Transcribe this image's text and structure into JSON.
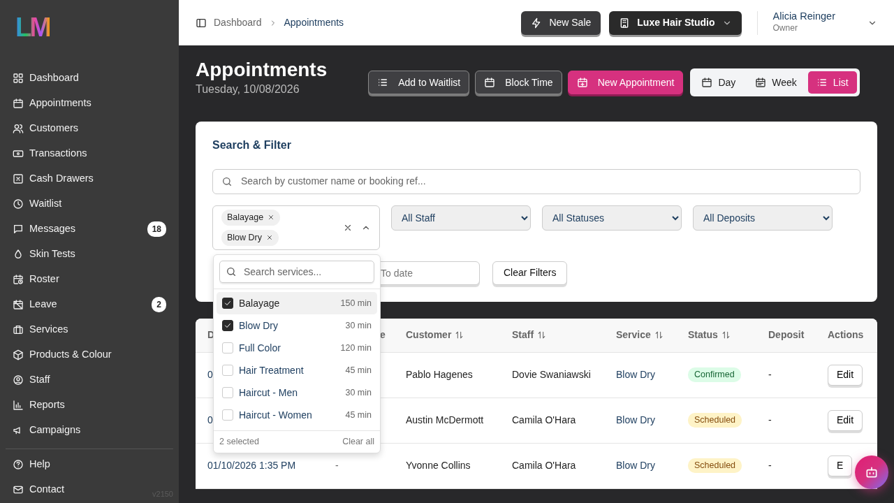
{
  "logo": {
    "text": "LM"
  },
  "sidebar": {
    "items": [
      {
        "label": "Dashboard"
      },
      {
        "label": "Appointments"
      },
      {
        "label": "Customers"
      },
      {
        "label": "Transactions"
      },
      {
        "label": "Cash Drawers"
      },
      {
        "label": "Waitlist"
      },
      {
        "label": "Messages",
        "badge": "18"
      },
      {
        "label": "Skin Tests"
      },
      {
        "label": "Roster"
      },
      {
        "label": "Leave",
        "badge": "2"
      },
      {
        "label": "Services"
      },
      {
        "label": "Products & Colour"
      },
      {
        "label": "Staff"
      },
      {
        "label": "Reports"
      },
      {
        "label": "Campaigns"
      }
    ],
    "footer_items": [
      {
        "label": "Help"
      },
      {
        "label": "Contact"
      }
    ],
    "version": "v2150"
  },
  "header": {
    "breadcrumb": [
      "Dashboard",
      "Appointments"
    ],
    "new_sale": "New Sale",
    "studio": "Luxe Hair Studio",
    "user": {
      "name": "Alicia Reinger",
      "role": "Owner"
    }
  },
  "page": {
    "title": "Appointments",
    "date": "Tuesday, 10/08/2026",
    "actions": [
      {
        "label": "Add to Waitlist",
        "kind": "secondary"
      },
      {
        "label": "Block Time",
        "kind": "secondary"
      },
      {
        "label": "New Appointment",
        "kind": "primary"
      }
    ],
    "views": [
      {
        "label": "Day",
        "selected": false
      },
      {
        "label": "Week",
        "selected": false
      },
      {
        "label": "List",
        "selected": true
      }
    ]
  },
  "filter": {
    "title": "Search & Filter",
    "search": {
      "placeholder": "Search by customer name or booking ref..."
    },
    "service_chips": [
      "Balayage",
      "Blow Dry"
    ],
    "selects": [
      "All Staff",
      "All Statuses",
      "All Deposits"
    ],
    "to_date": {
      "placeholder": "To date"
    },
    "clear_button": "Clear Filters"
  },
  "service_dropdown": {
    "search": {
      "placeholder": "Search services..."
    },
    "options": [
      {
        "name": "Balayage",
        "duration": "150 min",
        "checked": true,
        "highlighted": true
      },
      {
        "name": "Blow Dry",
        "duration": "30 min",
        "checked": true,
        "highlighted": false
      },
      {
        "name": "Full Color",
        "duration": "120 min",
        "checked": false,
        "highlighted": false
      },
      {
        "name": "Hair Treatment",
        "duration": "45 min",
        "checked": false,
        "highlighted": false
      },
      {
        "name": "Haircut - Men",
        "duration": "30 min",
        "checked": false,
        "highlighted": false
      },
      {
        "name": "Haircut - Women",
        "duration": "45 min",
        "checked": false,
        "highlighted": false
      }
    ],
    "count": "2 selected",
    "clear": "Clear all"
  },
  "table": {
    "columns": [
      {
        "label": "D"
      },
      {
        "label": "e"
      },
      {
        "label": "Customer",
        "sortable": true
      },
      {
        "label": "Staff",
        "sortable": true
      },
      {
        "label": "Service",
        "sortable": true
      },
      {
        "label": "Status",
        "sortable": true
      },
      {
        "label": "Deposit",
        "sortable": false
      },
      {
        "label": "Actions",
        "sortable": false
      }
    ],
    "rows": [
      {
        "date": "0",
        "customer": "Pablo Hagenes",
        "staff": "Dovie Swaniawski",
        "service": "Blow Dry",
        "status": {
          "label": "Confirmed",
          "kind": "confirmed"
        },
        "deposit": "-",
        "action": "Edit"
      },
      {
        "date": "0",
        "customer": "Austin McDermott",
        "staff": "Camila O'Hara",
        "service": "Blow Dry",
        "status": {
          "label": "Scheduled",
          "kind": "scheduled"
        },
        "deposit": "-",
        "action": "Edit"
      },
      {
        "date": "01/10/2026 1:35 PM",
        "column_2": "-",
        "customer": "Yvonne Collins",
        "staff": "Camila O'Hara",
        "service": "Blow Dry",
        "status": {
          "label": "Scheduled",
          "kind": "scheduled"
        },
        "deposit": "-",
        "action": "E"
      }
    ]
  }
}
